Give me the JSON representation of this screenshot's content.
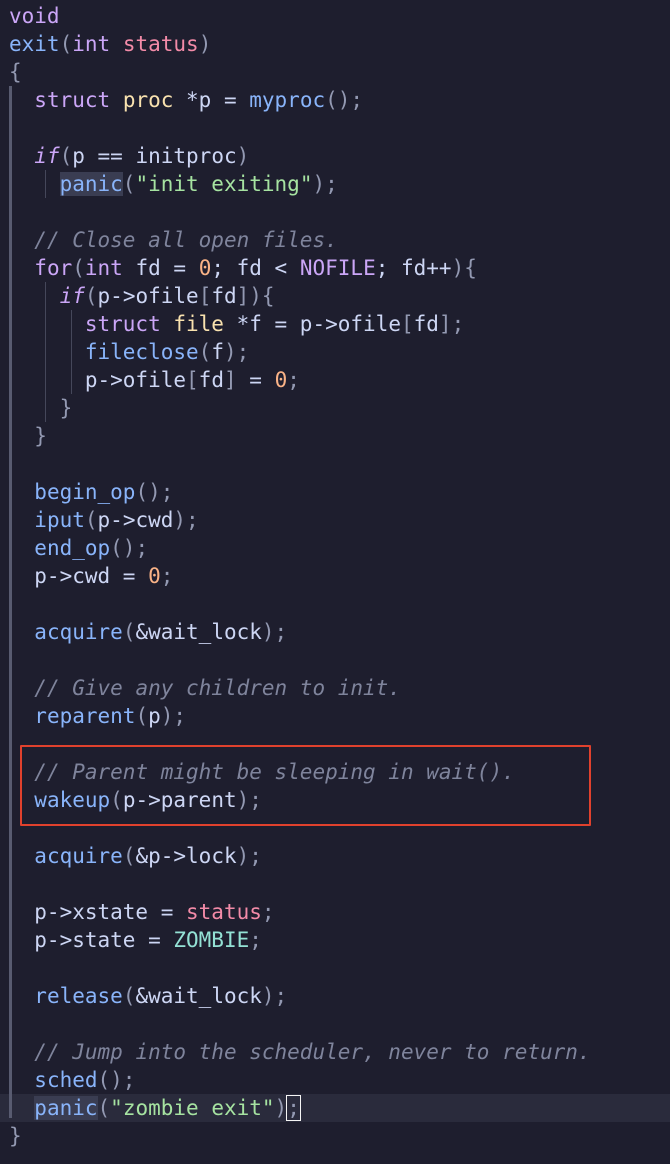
{
  "colors": {
    "background": "#1e1e2e",
    "keyword": "#cba6f7",
    "type": "#f9e2af",
    "function": "#89b4fa",
    "parameter": "#f38ba8",
    "number": "#fab387",
    "string": "#a6e3a1",
    "constant": "#94e2d5",
    "comment": "#7f849c",
    "annotation_box": "#e0412d"
  },
  "code": {
    "lines": [
      [
        [
          "kw",
          "void"
        ]
      ],
      [
        [
          "fn",
          "exit"
        ],
        [
          "punc",
          "("
        ],
        [
          "kw",
          "int"
        ],
        [
          "plain",
          " "
        ],
        [
          "param",
          "status"
        ],
        [
          "punc",
          ")"
        ]
      ],
      [
        [
          "punc",
          "{"
        ]
      ],
      [
        [
          "plain",
          "  "
        ],
        [
          "kw",
          "struct"
        ],
        [
          "plain",
          " "
        ],
        [
          "type",
          "proc"
        ],
        [
          "plain",
          " *p = "
        ],
        [
          "fn",
          "myproc"
        ],
        [
          "punc",
          "();"
        ]
      ],
      [],
      [
        [
          "plain",
          "  "
        ],
        [
          "kwi",
          "if"
        ],
        [
          "punc",
          "("
        ],
        [
          "plain",
          "p == initproc"
        ],
        [
          "punc",
          ")"
        ]
      ],
      [
        [
          "plain",
          "    "
        ],
        [
          "fnhl",
          "panic"
        ],
        [
          "punc",
          "("
        ],
        [
          "str",
          "\"init exiting\""
        ],
        [
          "punc",
          ");"
        ]
      ],
      [],
      [
        [
          "plain",
          "  "
        ],
        [
          "cmt",
          "// Close all open files."
        ]
      ],
      [
        [
          "plain",
          "  "
        ],
        [
          "kw",
          "for"
        ],
        [
          "punc",
          "("
        ],
        [
          "kw",
          "int"
        ],
        [
          "plain",
          " fd = "
        ],
        [
          "num",
          "0"
        ],
        [
          "plain",
          "; fd < "
        ],
        [
          "kw",
          "NOFILE"
        ],
        [
          "plain",
          "; fd++"
        ],
        [
          "punc",
          "){"
        ]
      ],
      [
        [
          "plain",
          "    "
        ],
        [
          "kwi",
          "if"
        ],
        [
          "punc",
          "("
        ],
        [
          "plain",
          "p->ofile"
        ],
        [
          "punc",
          "["
        ],
        [
          "plain",
          "fd"
        ],
        [
          "punc",
          "]){"
        ]
      ],
      [
        [
          "plain",
          "      "
        ],
        [
          "kw",
          "struct"
        ],
        [
          "plain",
          " "
        ],
        [
          "type",
          "file"
        ],
        [
          "plain",
          " *f = p->ofile"
        ],
        [
          "punc",
          "["
        ],
        [
          "plain",
          "fd"
        ],
        [
          "punc",
          "];"
        ]
      ],
      [
        [
          "plain",
          "      "
        ],
        [
          "fn",
          "fileclose"
        ],
        [
          "punc",
          "("
        ],
        [
          "plain",
          "f"
        ],
        [
          "punc",
          ");"
        ]
      ],
      [
        [
          "plain",
          "      p->ofile"
        ],
        [
          "punc",
          "["
        ],
        [
          "plain",
          "fd"
        ],
        [
          "punc",
          "]"
        ],
        [
          "plain",
          " = "
        ],
        [
          "num",
          "0"
        ],
        [
          "punc",
          ";"
        ]
      ],
      [
        [
          "plain",
          "    "
        ],
        [
          "punc",
          "}"
        ]
      ],
      [
        [
          "plain",
          "  "
        ],
        [
          "punc",
          "}"
        ]
      ],
      [],
      [
        [
          "plain",
          "  "
        ],
        [
          "fn",
          "begin_op"
        ],
        [
          "punc",
          "();"
        ]
      ],
      [
        [
          "plain",
          "  "
        ],
        [
          "fn",
          "iput"
        ],
        [
          "punc",
          "("
        ],
        [
          "plain",
          "p->cwd"
        ],
        [
          "punc",
          ");"
        ]
      ],
      [
        [
          "plain",
          "  "
        ],
        [
          "fn",
          "end_op"
        ],
        [
          "punc",
          "();"
        ]
      ],
      [
        [
          "plain",
          "  p->cwd = "
        ],
        [
          "num",
          "0"
        ],
        [
          "punc",
          ";"
        ]
      ],
      [],
      [
        [
          "plain",
          "  "
        ],
        [
          "fn",
          "acquire"
        ],
        [
          "punc",
          "("
        ],
        [
          "plain",
          "&wait_lock"
        ],
        [
          "punc",
          ");"
        ]
      ],
      [],
      [
        [
          "plain",
          "  "
        ],
        [
          "cmt",
          "// Give any children to init."
        ]
      ],
      [
        [
          "plain",
          "  "
        ],
        [
          "fn",
          "reparent"
        ],
        [
          "punc",
          "("
        ],
        [
          "plain",
          "p"
        ],
        [
          "punc",
          ");"
        ]
      ],
      [],
      [
        [
          "plain",
          "  "
        ],
        [
          "cmt",
          "// Parent might be sleeping in wait()."
        ]
      ],
      [
        [
          "plain",
          "  "
        ],
        [
          "fn",
          "wakeup"
        ],
        [
          "punc",
          "("
        ],
        [
          "plain",
          "p->parent"
        ],
        [
          "punc",
          ");"
        ]
      ],
      [],
      [
        [
          "plain",
          "  "
        ],
        [
          "fn",
          "acquire"
        ],
        [
          "punc",
          "("
        ],
        [
          "plain",
          "&p->lock"
        ],
        [
          "punc",
          ");"
        ]
      ],
      [],
      [
        [
          "plain",
          "  p->xstate = "
        ],
        [
          "param",
          "status"
        ],
        [
          "punc",
          ";"
        ]
      ],
      [
        [
          "plain",
          "  p->state = "
        ],
        [
          "const",
          "ZOMBIE"
        ],
        [
          "punc",
          ";"
        ]
      ],
      [],
      [
        [
          "plain",
          "  "
        ],
        [
          "fn",
          "release"
        ],
        [
          "punc",
          "("
        ],
        [
          "plain",
          "&wait_lock"
        ],
        [
          "punc",
          ");"
        ]
      ],
      [],
      [
        [
          "plain",
          "  "
        ],
        [
          "cmt",
          "// Jump into the scheduler, never to return."
        ]
      ],
      [
        [
          "plain",
          "  "
        ],
        [
          "fn",
          "sched"
        ],
        [
          "punc",
          "();"
        ]
      ],
      [
        [
          "plain",
          "  "
        ],
        [
          "fnhl",
          "panic"
        ],
        [
          "punc",
          "("
        ],
        [
          "str",
          "\"zombie exit\""
        ],
        [
          "punc",
          ")"
        ],
        [
          "cursor",
          ";"
        ]
      ],
      [
        [
          "punc",
          "}"
        ]
      ]
    ]
  }
}
